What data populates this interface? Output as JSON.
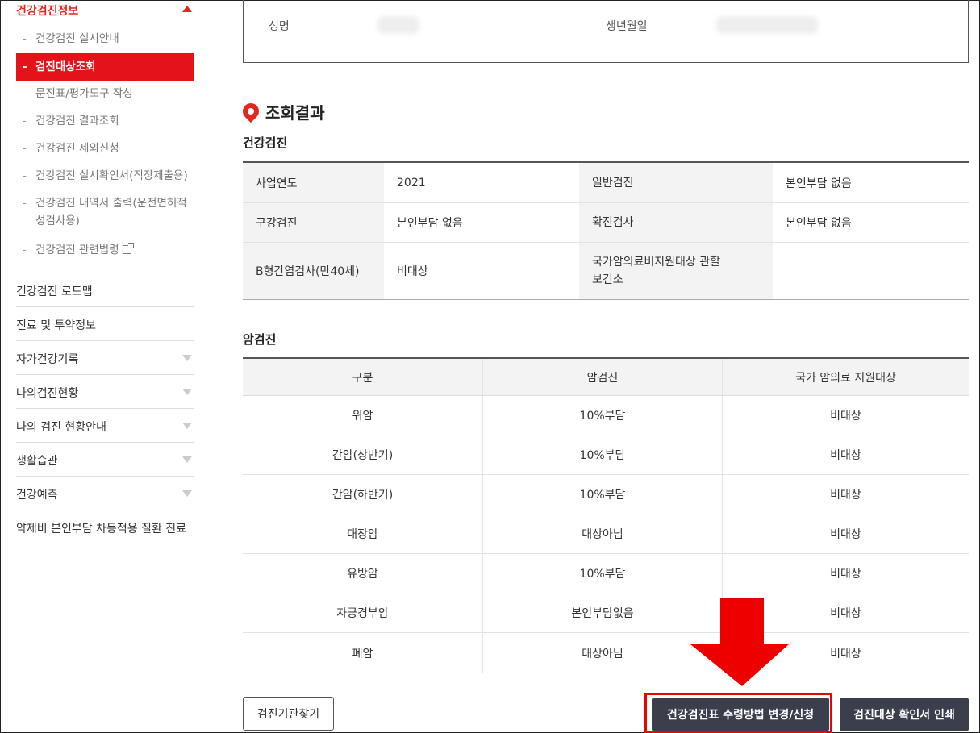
{
  "sidebar": {
    "header": "건강검진정보",
    "subitems": [
      {
        "label": "건강검진 실시안내",
        "active": false
      },
      {
        "label": "검진대상조회",
        "active": true
      },
      {
        "label": "문진표/평가도구 작성",
        "active": false
      },
      {
        "label": "건강검진 결과조회",
        "active": false
      },
      {
        "label": "건강검진 제외신청",
        "active": false
      },
      {
        "label": "건강검진 실시확인서(직장제출용)",
        "active": false
      },
      {
        "label": "건강검진 내역서 출력(운전면허적성검사용)",
        "active": false
      },
      {
        "label": "건강검진 관련법령",
        "active": false
      }
    ],
    "menus": [
      {
        "label": "건강검진 로드맵",
        "expandable": false
      },
      {
        "label": "진료 및 투약정보",
        "expandable": false
      },
      {
        "label": "자가건강기록",
        "expandable": true
      },
      {
        "label": "나의검진현황",
        "expandable": true
      },
      {
        "label": "나의 검진 현황안내",
        "expandable": true
      },
      {
        "label": "생활습관",
        "expandable": true
      },
      {
        "label": "건강예측",
        "expandable": true
      },
      {
        "label": "약제비 본인부담 차등적용 질환 진료",
        "expandable": false
      }
    ]
  },
  "info": {
    "name_label": "성명",
    "birth_label": "생년월일"
  },
  "result": {
    "title": "조회결과",
    "health_section": "건강검진",
    "health_rows": [
      {
        "k1": "사업연도",
        "v1": "2021",
        "k2": "일반검진",
        "v2": "본인부담 없음"
      },
      {
        "k1": "구강검진",
        "v1": "본인부담 없음",
        "k2": "확진검사",
        "v2": "본인부담 없음"
      },
      {
        "k1": "B형간염검사(만40세)",
        "v1": "비대상",
        "k2": "국가암의료비지원대상 관할보건소",
        "v2": ""
      }
    ],
    "cancer_section": "암검진",
    "cancer_headers": [
      "구분",
      "암검진",
      "국가 암의료 지원대상"
    ],
    "cancer_rows": [
      [
        "위암",
        "10%부담",
        "비대상"
      ],
      [
        "간암(상반기)",
        "10%부담",
        "비대상"
      ],
      [
        "간암(하반기)",
        "10%부담",
        "비대상"
      ],
      [
        "대장암",
        "대상아님",
        "비대상"
      ],
      [
        "유방암",
        "10%부담",
        "비대상"
      ],
      [
        "자궁경부암",
        "본인부담없음",
        "비대상"
      ],
      [
        "폐암",
        "대상아님",
        "비대상"
      ]
    ]
  },
  "buttons": {
    "find_center": "검진기관찾기",
    "change_method": "건강검진표 수령방법 변경/신청",
    "print_confirm": "검진대상 확인서 인쇄"
  },
  "colors": {
    "accent": "#e4261f",
    "active_bg": "#e4131a",
    "dark_button": "#3b3f4c",
    "annotation": "#ee0000"
  }
}
